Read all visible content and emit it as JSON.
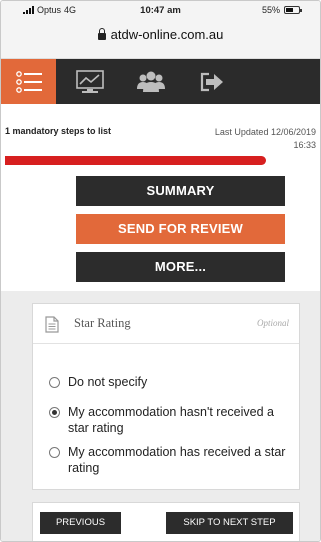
{
  "status_bar": {
    "carrier": "Optus",
    "network": "4G",
    "time": "10:47 am",
    "battery": "55%",
    "battery_level": 0.55
  },
  "browser": {
    "url": "atdw-online.com.au"
  },
  "nav": {
    "items": [
      {
        "icon": "list-menu-icon",
        "active": true
      },
      {
        "icon": "monitor-chart-icon",
        "active": false
      },
      {
        "icon": "users-group-icon",
        "active": false
      },
      {
        "icon": "sign-out-icon",
        "active": false
      }
    ],
    "active_color": "#e2693a",
    "bar_color": "#2b2b2b"
  },
  "listing": {
    "mandatory_text": "1 mandatory steps to list",
    "last_updated_label": "Last Updated 12/06/2019",
    "last_updated_time": "16:33",
    "progress_fraction": 0.83,
    "progress_color": "#d71f1f"
  },
  "actions": {
    "summary_label": "SUMMARY",
    "review_label": "SEND FOR REVIEW",
    "more_label": "MORE..."
  },
  "section": {
    "title": "Star Rating",
    "optional_label": "Optional",
    "options": [
      {
        "label": "Do not specify",
        "checked": false
      },
      {
        "label": "My accommodation hasn't received a star rating",
        "checked": true
      },
      {
        "label": "My accommodation has received a star rating",
        "checked": false
      }
    ]
  },
  "footer": {
    "previous_label": "PREVIOUS",
    "skip_label": "SKIP TO NEXT STEP"
  }
}
